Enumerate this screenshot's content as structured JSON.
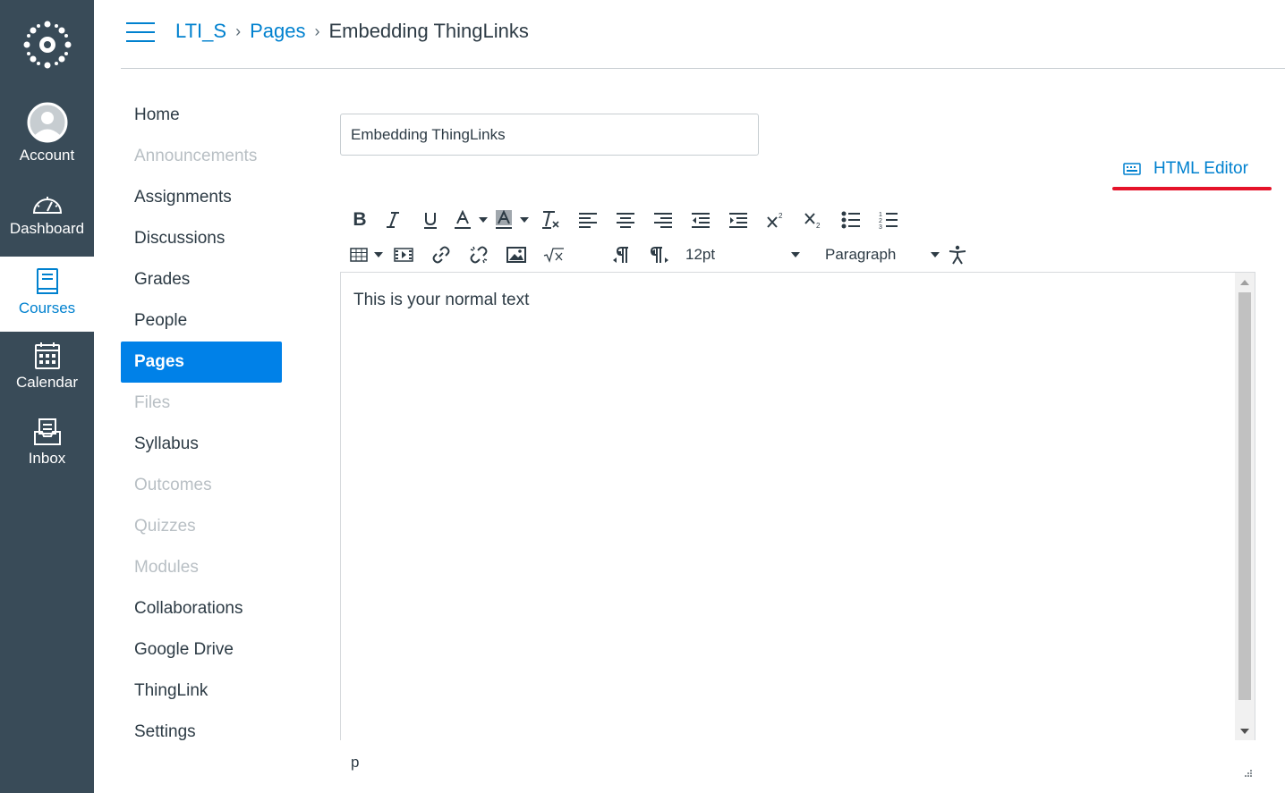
{
  "global_nav": {
    "items": [
      {
        "label": "Account",
        "icon": "avatar-icon"
      },
      {
        "label": "Dashboard",
        "icon": "dashboard-icon"
      },
      {
        "label": "Courses",
        "icon": "courses-icon",
        "active": true
      },
      {
        "label": "Calendar",
        "icon": "calendar-icon"
      },
      {
        "label": "Inbox",
        "icon": "inbox-icon"
      }
    ],
    "colors": {
      "background": "#394b58",
      "active_text": "#0081cf"
    }
  },
  "header": {
    "breadcrumbs": [
      "LTI_S",
      "Pages",
      "Embedding ThingLinks"
    ]
  },
  "course_nav": {
    "items": [
      {
        "label": "Home",
        "state": "enabled"
      },
      {
        "label": "Announcements",
        "state": "disabled"
      },
      {
        "label": "Assignments",
        "state": "enabled"
      },
      {
        "label": "Discussions",
        "state": "enabled"
      },
      {
        "label": "Grades",
        "state": "enabled"
      },
      {
        "label": "People",
        "state": "enabled"
      },
      {
        "label": "Pages",
        "state": "active"
      },
      {
        "label": "Files",
        "state": "disabled"
      },
      {
        "label": "Syllabus",
        "state": "enabled"
      },
      {
        "label": "Outcomes",
        "state": "disabled"
      },
      {
        "label": "Quizzes",
        "state": "disabled"
      },
      {
        "label": "Modules",
        "state": "disabled"
      },
      {
        "label": "Collaborations",
        "state": "enabled"
      },
      {
        "label": "Google Drive",
        "state": "enabled"
      },
      {
        "label": "ThingLink",
        "state": "enabled"
      },
      {
        "label": "Settings",
        "state": "enabled"
      }
    ]
  },
  "editor": {
    "title_value": "Embedding ThingLinks",
    "html_editor_label": "HTML Editor",
    "font_size": "12pt",
    "block_format": "Paragraph",
    "content_text": "This is your normal text",
    "status_path": "p",
    "toolbar_icons": [
      "bold-icon",
      "italic-icon",
      "underline-icon",
      "text-color-icon",
      "background-color-icon",
      "clear-formatting-icon",
      "align-left-icon",
      "align-center-icon",
      "align-right-icon",
      "outdent-icon",
      "indent-icon",
      "superscript-icon",
      "subscript-icon",
      "bullet-list-icon",
      "numbered-list-icon",
      "table-icon",
      "media-icon",
      "link-icon",
      "unlink-icon",
      "image-icon",
      "equation-icon",
      "ltr-icon",
      "rtl-icon",
      "accessibility-icon"
    ]
  },
  "colors": {
    "accent": "#0081cf",
    "active_nav": "#0081e8",
    "highlight_underline": "#e5132a"
  }
}
